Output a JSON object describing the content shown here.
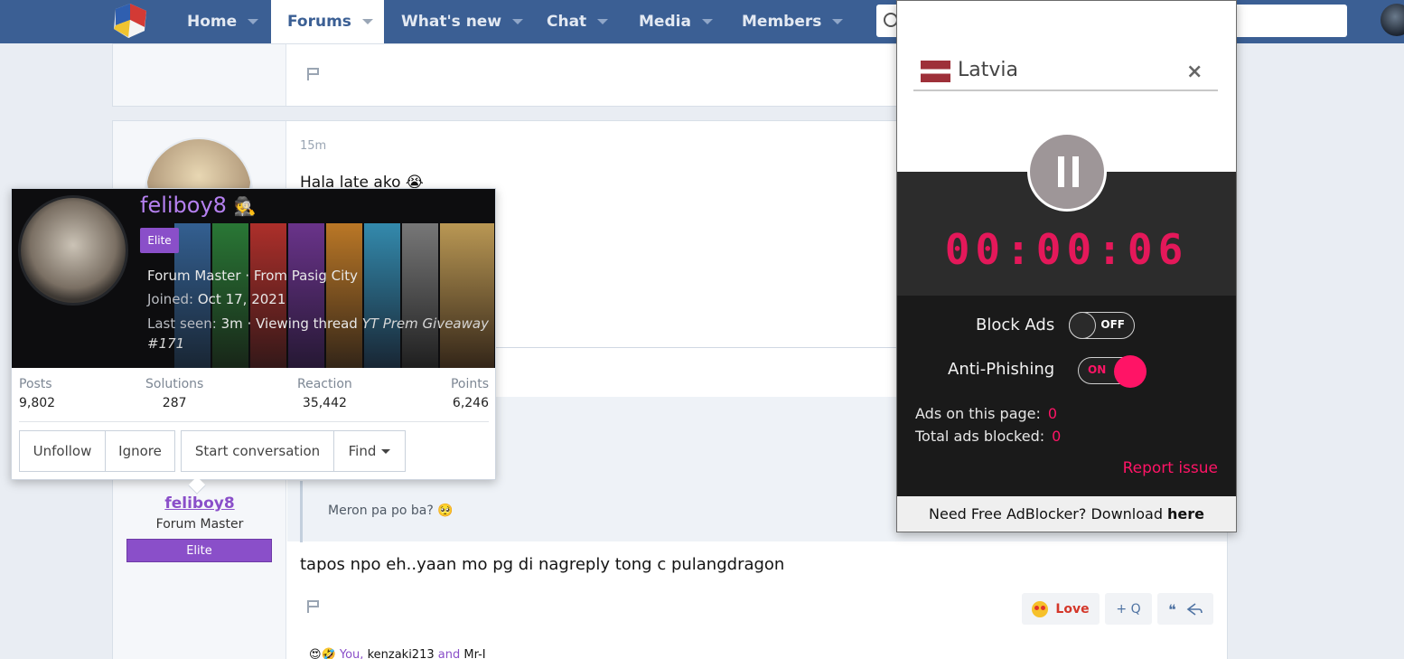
{
  "nav": {
    "tabs": [
      {
        "label": "Home"
      },
      {
        "label": "Forums"
      },
      {
        "label": "What's new"
      },
      {
        "label": "Chat"
      },
      {
        "label": "Media"
      },
      {
        "label": "Members"
      }
    ],
    "active_tab": "Forums"
  },
  "post": {
    "time": "15m",
    "text": "Hala late ako 😭",
    "quote_text": "Meron pa po ba? 🥺",
    "reply_text": "tapos npo eh..yaan mo pg di nagreply tong c pulangdragon",
    "author": {
      "username": "feliboy8",
      "title": "Forum Master",
      "banner": "Elite"
    },
    "actions": {
      "love_label": "Love",
      "plus_quote_label": "+ Q"
    },
    "reactions": {
      "you": "You,",
      "user1": "kenzaki213",
      "and": "and",
      "user2": "Mr-I"
    }
  },
  "member_card": {
    "username": "feliboy8",
    "badge": "Elite",
    "line1": "Forum Master · From Pasig City",
    "joined_label": "Joined:",
    "joined_value": "Oct 17, 2021",
    "seen_label": "Last seen:",
    "seen_value": "3m · Viewing thread",
    "thread_title": "YT Prem Giveaway",
    "thread_num": "#171",
    "stats": [
      {
        "label": "Posts",
        "value": "9,802"
      },
      {
        "label": "Solutions",
        "value": "287"
      },
      {
        "label": "Reaction",
        "value": "35,442"
      },
      {
        "label": "Points",
        "value": "6,246"
      }
    ],
    "buttons": {
      "unfollow": "Unfollow",
      "ignore": "Ignore",
      "start_conversation": "Start conversation",
      "find": "Find"
    }
  },
  "vpn_popup": {
    "country": "Latvia",
    "timer": "00:00:06",
    "block_ads_label": "Block Ads",
    "block_ads_state": "OFF",
    "anti_phishing_label": "Anti-Phishing",
    "anti_phishing_state": "ON",
    "ads_on_page_label": "Ads on this page:",
    "ads_on_page_value": "0",
    "total_blocked_label": "Total ads blocked:",
    "total_blocked_value": "0",
    "report_issue": "Report issue",
    "footer_text": "Need Free AdBlocker? Download",
    "footer_link": "here",
    "accent_color": "#ff1466"
  },
  "colors": {
    "nav_bg": "#3b5f94",
    "elite_purple": "#8a4fc9"
  }
}
